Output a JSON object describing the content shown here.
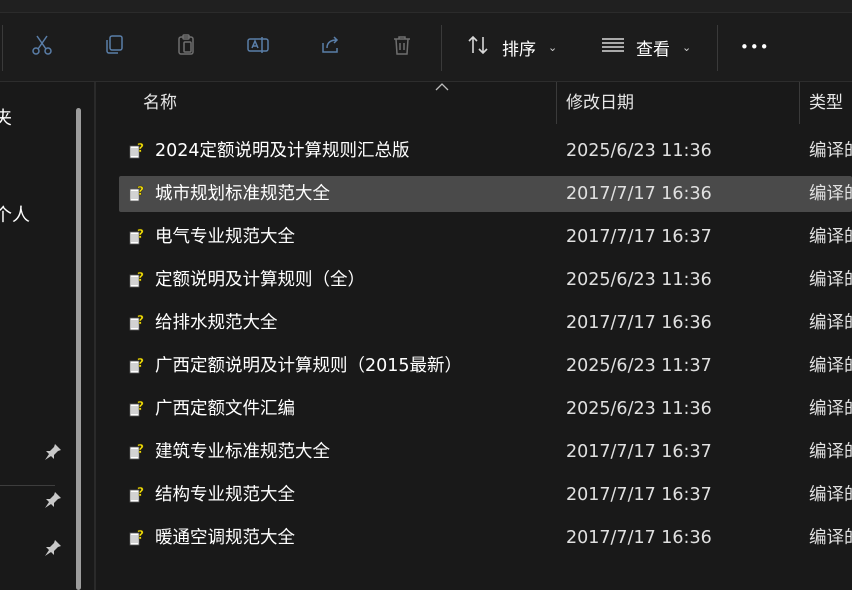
{
  "toolbar": {
    "buttons": [
      {
        "name": "cut-icon"
      },
      {
        "name": "copy-icon"
      },
      {
        "name": "paste-icon"
      },
      {
        "name": "rename-icon"
      },
      {
        "name": "share-icon"
      },
      {
        "name": "delete-icon"
      }
    ],
    "sort_label": "排序",
    "view_label": "查看",
    "more_label": "•••"
  },
  "sidebar": {
    "partial_item_1": "夹",
    "partial_item_2": "个人",
    "pinned_icons": [
      "pin-icon",
      "pin-icon",
      "pin-icon"
    ]
  },
  "columns": {
    "name": "名称",
    "date_modified": "修改日期",
    "type": "类型"
  },
  "files": [
    {
      "name": "2024定额说明及计算规则汇总版",
      "date": "2025/6/23 11:36",
      "type": "编译的"
    },
    {
      "name": "城市规划标准规范大全",
      "date": "2017/7/17 16:36",
      "type": "编译的",
      "selected": true
    },
    {
      "name": "电气专业规范大全",
      "date": "2017/7/17 16:37",
      "type": "编译的"
    },
    {
      "name": "定额说明及计算规则（全）",
      "date": "2025/6/23 11:36",
      "type": "编译的"
    },
    {
      "name": "给排水规范大全",
      "date": "2017/7/17 16:36",
      "type": "编译的"
    },
    {
      "name": "广西定额说明及计算规则（2015最新）",
      "date": "2025/6/23 11:37",
      "type": "编译的"
    },
    {
      "name": "广西定额文件汇编",
      "date": "2025/6/23 11:36",
      "type": "编译的"
    },
    {
      "name": "建筑专业标准规范大全",
      "date": "2017/7/17 16:37",
      "type": "编译的"
    },
    {
      "name": "结构专业规范大全",
      "date": "2017/7/17 16:37",
      "type": "编译的"
    },
    {
      "name": "暖通空调规范大全",
      "date": "2017/7/17 16:36",
      "type": "编译的"
    }
  ]
}
